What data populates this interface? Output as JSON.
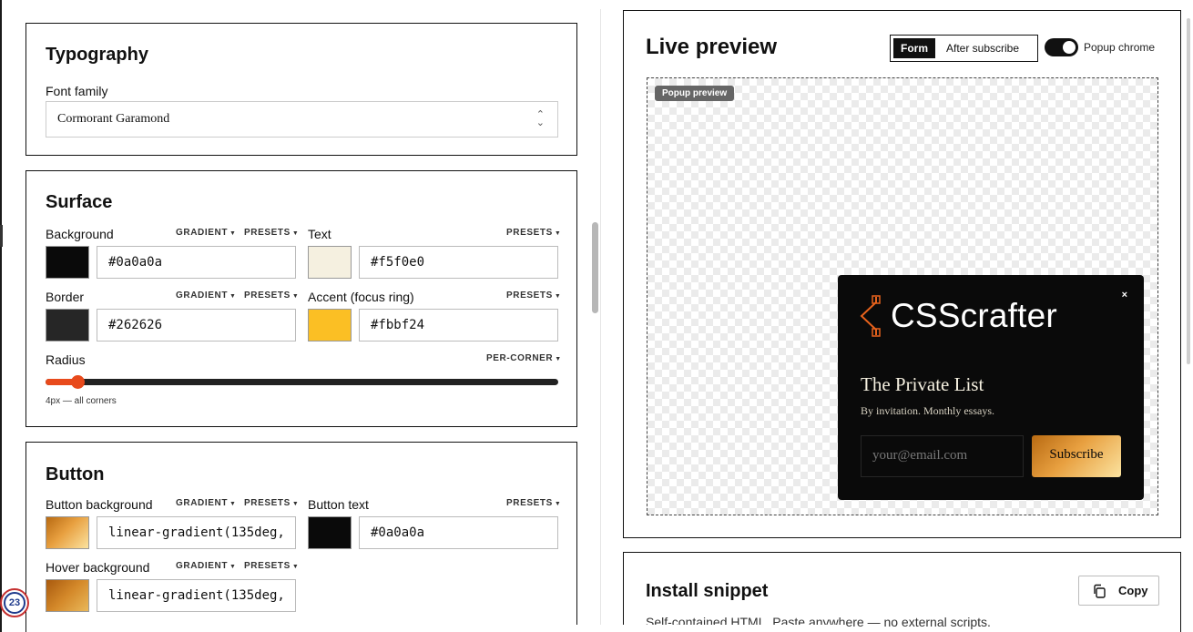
{
  "typography": {
    "title": "Typography",
    "font_family_label": "Font family",
    "font_family_value": "Cormorant Garamond"
  },
  "surface": {
    "title": "Surface",
    "background_label": "Background",
    "background_value": "#0a0a0a",
    "text_label": "Text",
    "text_value": "#f5f0e0",
    "border_label": "Border",
    "border_value": "#262626",
    "accent_label": "Accent (focus ring)",
    "accent_value": "#fbbf24",
    "radius_label": "Radius",
    "radius_value": 4,
    "radius_max": 64,
    "radius_caption": "4px — all corners",
    "gradient_link": "GRADIENT",
    "presets_link": "PRESETS",
    "per_corner_link": "PER-CORNER"
  },
  "button": {
    "title": "Button",
    "bg_label": "Button background",
    "bg_value": "linear-gradient(135deg,",
    "text_label": "Button text",
    "text_value": "#0a0a0a",
    "hover_label": "Hover background",
    "hover_value": "linear-gradient(135deg,",
    "gradient_link": "GRADIENT",
    "presets_link": "PRESETS"
  },
  "preview": {
    "title": "Live preview",
    "tab_form": "Form",
    "tab_after": "After subscribe",
    "toggle_label": "Popup chrome",
    "toggle_on": true,
    "stage_badge": "Popup preview",
    "popup": {
      "close": "×",
      "logo_text": "CSScrafter",
      "heading": "The Private List",
      "subtitle": "By invitation. Monthly essays.",
      "email_placeholder": "your@email.com",
      "submit_label": "Subscribe"
    }
  },
  "install": {
    "title": "Install snippet",
    "copy_label": "Copy",
    "description": "Self-contained HTML. Paste anywhere — no external scripts."
  },
  "notification_badge": "23",
  "colors": {
    "background": "#0a0a0a",
    "text": "#f5f0e0",
    "border": "#262626",
    "accent": "#fbbf24",
    "slider": "#e84a1c",
    "logo_orange": "#e8621c"
  }
}
